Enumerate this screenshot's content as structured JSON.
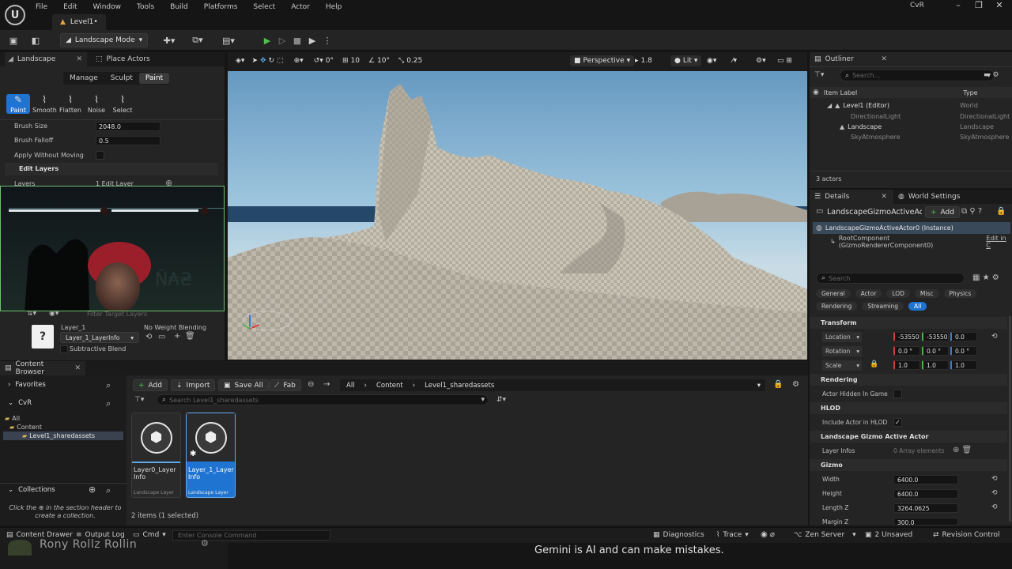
{
  "menu": [
    "File",
    "Edit",
    "Window",
    "Tools",
    "Build",
    "Platforms",
    "Select",
    "Actor",
    "Help"
  ],
  "level_tab": "Level1•",
  "project_name": "CvR",
  "toolbar": {
    "mode_label": "Landscape Mode"
  },
  "landscape_panel": {
    "tab_label": "Landscape",
    "place_actors_label": "Place Actors",
    "modes": [
      "Manage",
      "Sculpt",
      "Paint"
    ],
    "tools": [
      "Paint",
      "Smooth",
      "Flatten",
      "Noise",
      "Select"
    ],
    "brush_size_label": "Brush Size",
    "brush_size_value": "2048.0",
    "brush_falloff_label": "Brush Falloff",
    "brush_falloff_value": "0.5",
    "apply_label": "Apply Without Moving",
    "edit_layers_label": "Edit Layers",
    "layers_label": "Layers",
    "layers_value": "1 Edit Layer",
    "filter_placeholder": "Filter Target Layers",
    "layer_name": "Layer_1",
    "layer_info": "Layer_1_LayerInfo",
    "weight_blending": "No Weight Blending",
    "subtractive_label": "Subtractive Blend"
  },
  "viewport": {
    "perspective": "Perspective",
    "lit": "Lit",
    "speed": "1.8",
    "snap_translate": "10",
    "snap_rotate": "10°",
    "snap_scale": "0.25",
    "rot_value": "0°"
  },
  "outliner": {
    "tab_label": "Outliner",
    "search_placeholder": "Search...",
    "col_label": "Item Label",
    "col_type": "Type",
    "rows": [
      {
        "label": "Level1 (Editor)",
        "type": "World"
      },
      {
        "label": "DirectionalLight",
        "type": "DirectionalLight"
      },
      {
        "label": "Landscape",
        "type": "Landscape"
      },
      {
        "label": "SkyAtmosphere",
        "type": "SkyAtmosphere"
      }
    ],
    "count": "3 actors"
  },
  "details": {
    "tab_label": "Details",
    "world_settings_label": "World Settings",
    "actor_name": "LandscapeGizmoActiveAc",
    "add_label": "Add",
    "instance": "LandscapeGizmoActiveActor0 (Instance)",
    "root_component": "RootComponent (GizmoRendererComponent0)",
    "edit_in": "Edit in C",
    "search_placeholder": "Search",
    "filters": [
      "General",
      "Actor",
      "LOD",
      "Misc",
      "Physics",
      "Rendering",
      "Streaming",
      "All"
    ],
    "transform_label": "Transform",
    "location_label": "Location",
    "location": [
      "-53550",
      "-53550",
      "0.0"
    ],
    "rotation_label": "Rotation",
    "rotation": [
      "0.0 °",
      "0.0 °",
      "0.0 °"
    ],
    "scale_label": "Scale",
    "scale": [
      "1.0",
      "1.0",
      "1.0"
    ],
    "rendering_label": "Rendering",
    "hidden_label": "Actor Hidden In Game",
    "hlod_label": "HLOD",
    "include_hlod_label": "Include Actor in HLOD",
    "gizmo_actor_label": "Landscape Gizmo Active Actor",
    "layer_infos_label": "Layer Infos",
    "layer_infos_value": "0 Array elements",
    "gizmo_label": "Gizmo",
    "width_label": "Width",
    "width_value": "6400.0",
    "height_label": "Height",
    "height_value": "6400.0",
    "length_label": "Length Z",
    "length_value": "3264.0625",
    "margin_label": "Margin Z",
    "margin_value": "300.0"
  },
  "content_browser": {
    "tab_label": "Content Browser",
    "add_label": "Add",
    "import_label": "Import",
    "save_all_label": "Save All",
    "fab_label": "Fab",
    "breadcrumb": [
      "All",
      "Content",
      "Level1_sharedassets"
    ],
    "favorites_label": "Favorites",
    "project_label": "CvR",
    "tree": [
      "All",
      "Content",
      "Level1_sharedassets"
    ],
    "search_placeholder": "Search Level1_sharedassets",
    "assets": [
      {
        "name": "Layer0_Layer Info",
        "type": "Landscape Layer"
      },
      {
        "name": "Layer_1_Layer Info",
        "type": "Landscape Layer"
      }
    ],
    "item_count": "2 items (1 selected)",
    "collections_label": "Collections",
    "collections_hint_a": "Click the",
    "collections_hint_b": "in the section header to",
    "collections_hint_c": "create a collection."
  },
  "statusbar": {
    "content_drawer": "Content Drawer",
    "output_log": "Output Log",
    "cmd": "Cmd",
    "console_placeholder": "Enter Console Command",
    "diagnostics": "Diagnostics",
    "trace": "Trace",
    "zen": "Zen Server",
    "unsaved": "2 Unsaved",
    "revision": "Revision Control"
  },
  "overlay": {
    "names": "Rony  Rollz  Rollin",
    "gemini": "Gemini is AI and can make mistakes."
  }
}
